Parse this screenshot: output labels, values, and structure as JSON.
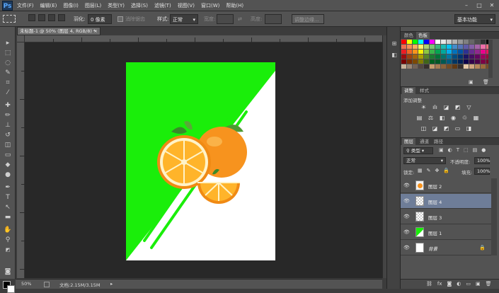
{
  "app": {
    "logo": "Ps"
  },
  "menu": [
    "文件(F)",
    "编辑(E)",
    "图像(I)",
    "图层(L)",
    "类型(Y)",
    "选择(S)",
    "滤镜(T)",
    "视图(V)",
    "窗口(W)",
    "帮助(H)"
  ],
  "window_controls": [
    "–",
    "□",
    "✕"
  ],
  "options": {
    "feather_label": "羽化:",
    "feather_value": "0 像素",
    "antialias_label": "消除锯齿",
    "style_label": "样式:",
    "style_value": "正常",
    "width_label": "宽度:",
    "height_label": "高度:",
    "refine_button": "调整边缘...",
    "workspace": "基本功能"
  },
  "document": {
    "tab_title": "未标题-1 @ 50% (图层 4, RGB/8) *",
    "close": "×",
    "colors": {
      "green": "#1aee0a",
      "white": "#ffffff",
      "orange": "#f7931e"
    }
  },
  "status": {
    "zoom": "50%",
    "doc_info": "文档:2.15M/3.15M"
  },
  "panels": {
    "color_tabs": [
      "颜色",
      "色板"
    ],
    "adjust_tabs": [
      "调整",
      "样式"
    ],
    "adjust_title": "添加调整",
    "layers_tabs": [
      "图层",
      "通道",
      "路径"
    ],
    "filter_kind": "类型",
    "blend_mode": "正常",
    "opacity_label": "不透明度:",
    "opacity_value": "100%",
    "lock_label": "锁定:",
    "fill_label": "填充:",
    "fill_value": "100%"
  },
  "layers": [
    {
      "name": "图层 2",
      "thumb": "orange",
      "selected": false
    },
    {
      "name": "图层 4",
      "thumb": "checker",
      "selected": true
    },
    {
      "name": "图层 3",
      "thumb": "checker",
      "selected": false
    },
    {
      "name": "图层 1",
      "thumb": "green",
      "selected": false
    },
    {
      "name": "背景",
      "thumb": "white",
      "selected": false
    }
  ],
  "swatches": [
    "#ff0000",
    "#ffff00",
    "#00ff00",
    "#00ffff",
    "#0000ff",
    "#ff00ff",
    "#ffffff",
    "#e6e6e6",
    "#cccccc",
    "#b3b3b3",
    "#999999",
    "#808080",
    "#666666",
    "#4d4d4d",
    "#333333",
    "#000000",
    "#f26c4f",
    "#f68e55",
    "#fbaf5c",
    "#fff467",
    "#acd372",
    "#7cc576",
    "#3bb878",
    "#1abbb4",
    "#00bff3",
    "#438ccb",
    "#5574b9",
    "#605ca8",
    "#855fa8",
    "#a763a8",
    "#f06ea9",
    "#f26d7d",
    "#ed1c24",
    "#f26522",
    "#f7941d",
    "#fff200",
    "#8dc73f",
    "#39b54a",
    "#00a651",
    "#00a99d",
    "#00aeef",
    "#0072bc",
    "#0054a6",
    "#2e3192",
    "#662d91",
    "#92278f",
    "#ec008c",
    "#ed145b",
    "#9e0b0f",
    "#a0410d",
    "#a36209",
    "#aba000",
    "#598527",
    "#1a7b30",
    "#007236",
    "#00746b",
    "#0076a3",
    "#004b80",
    "#003471",
    "#1b1464",
    "#440e62",
    "#630460",
    "#9e005d",
    "#9e0039",
    "#790000",
    "#7b2e00",
    "#7d4900",
    "#827b00",
    "#406618",
    "#005e20",
    "#005826",
    "#005952",
    "#005b7f",
    "#003663",
    "#002157",
    "#0d004c",
    "#32004b",
    "#4b0049",
    "#7b0046",
    "#7a0026",
    "#c7b299",
    "#998675",
    "#736357",
    "#534741",
    "#37302d",
    "#c69c6d",
    "#a67c52",
    "#8c6239",
    "#754c24",
    "#603913",
    "#362f2d",
    "#e6c9a8",
    "#d1a57e",
    "#b8865a",
    "#9c6a3c",
    "#7a4f26"
  ]
}
